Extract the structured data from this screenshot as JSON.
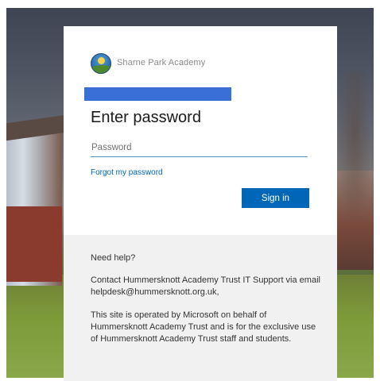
{
  "org": {
    "name": "Sharne Park Academy"
  },
  "login": {
    "title": "Enter password",
    "password_placeholder": "Password",
    "password_value": "",
    "forgot_link": "Forgot my password",
    "signin_label": "Sign in"
  },
  "help": {
    "heading": "Need help?",
    "contact": "Contact Hummersknott Academy Trust IT Support via email helpdesk@hummersknott.org.uk,",
    "notice": "This site is operated by Microsoft on behalf of Hummersknott Academy Trust and is for the exclusive use of Hummersknott Academy Trust staff and students."
  },
  "colors": {
    "accent": "#0067b8",
    "redaction": "#3a6fd8",
    "help_background": "#f1f1f1"
  },
  "icons": {
    "logo": "school-logo-icon"
  }
}
